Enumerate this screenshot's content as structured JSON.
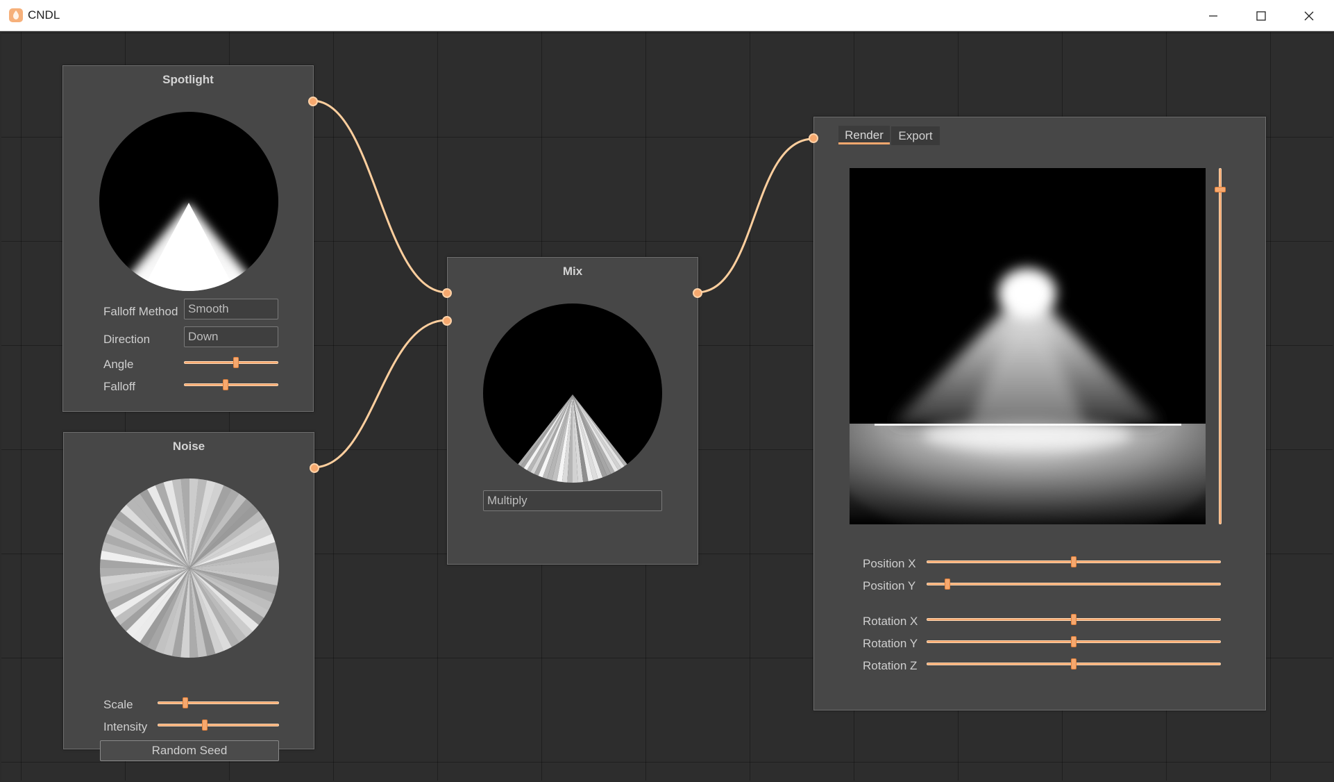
{
  "window": {
    "title": "CNDL",
    "icon": "app-logo-icon",
    "controls": [
      "minimize-icon",
      "maximize-icon",
      "close-icon"
    ]
  },
  "accent_color": "#f6a86e",
  "nodes": {
    "spotlight": {
      "title": "Spotlight",
      "falloff_method": {
        "label": "Falloff Method",
        "value": "Smooth"
      },
      "direction": {
        "label": "Direction",
        "value": "Down"
      },
      "angle": {
        "label": "Angle",
        "level": 0.55
      },
      "falloff": {
        "label": "Falloff",
        "level": 0.44
      }
    },
    "noise": {
      "title": "Noise",
      "scale": {
        "label": "Scale",
        "level": 0.23
      },
      "intensity": {
        "label": "Intensity",
        "level": 0.39
      },
      "random_seed_label": "Random Seed"
    },
    "mix": {
      "title": "Mix",
      "mode": "Multiply"
    },
    "output": {
      "tabs": [
        "Render",
        "Export"
      ],
      "active_tab": "Render",
      "zoom_level": 0.94,
      "position_x": {
        "label": "Position X",
        "level": 0.5
      },
      "position_y": {
        "label": "Position Y",
        "level": 0.07
      },
      "rotation_x": {
        "label": "Rotation X",
        "level": 0.5
      },
      "rotation_y": {
        "label": "Rotation Y",
        "level": 0.5
      },
      "rotation_z": {
        "label": "Rotation Z",
        "level": 0.5
      }
    }
  }
}
